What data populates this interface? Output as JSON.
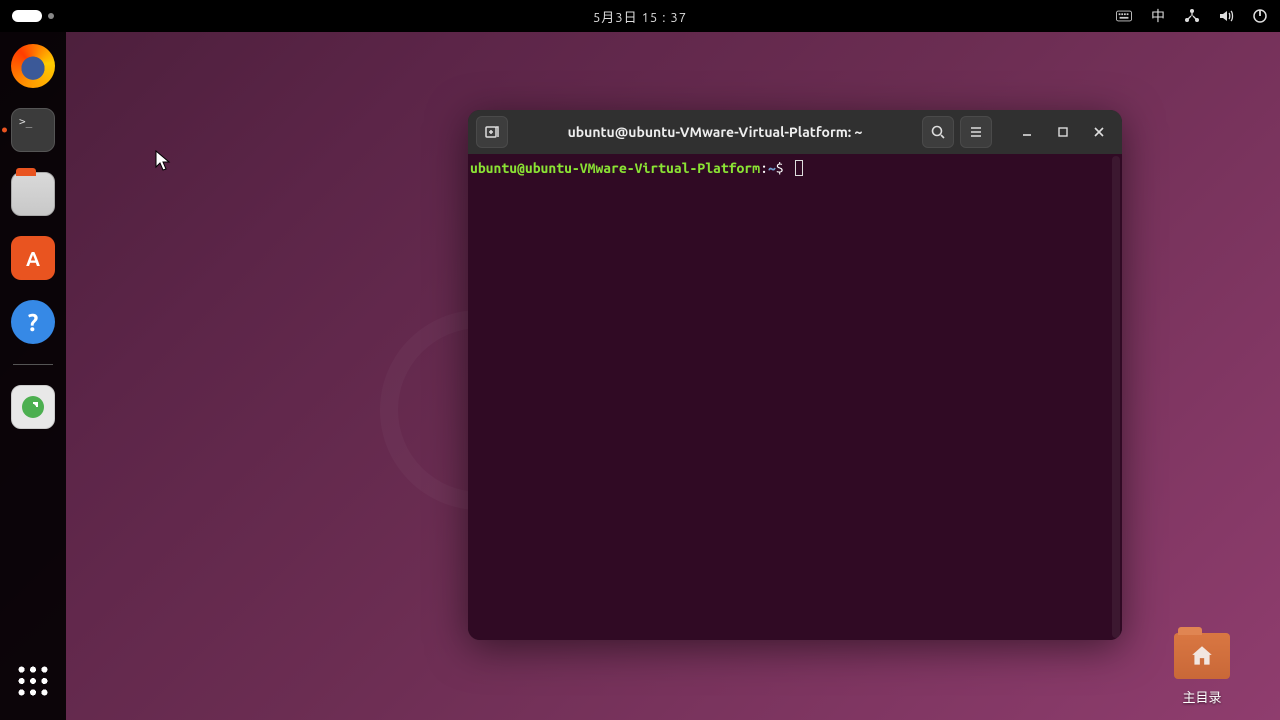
{
  "topbar": {
    "datetime": "5月3日 15 : 37",
    "ime_label": "中"
  },
  "dock": {
    "items": [
      {
        "name": "firefox"
      },
      {
        "name": "terminal",
        "running": true
      },
      {
        "name": "files"
      },
      {
        "name": "software"
      },
      {
        "name": "help"
      },
      {
        "name": "trash"
      }
    ]
  },
  "terminal": {
    "title": "ubuntu@ubuntu-VMware-Virtual-Platform: ~",
    "prompt_user": "ubuntu@ubuntu-VMware-Virtual-Platform",
    "prompt_colon": ":",
    "prompt_path": "~",
    "prompt_dollar": "$"
  },
  "desktop": {
    "home_label": "主目录"
  }
}
